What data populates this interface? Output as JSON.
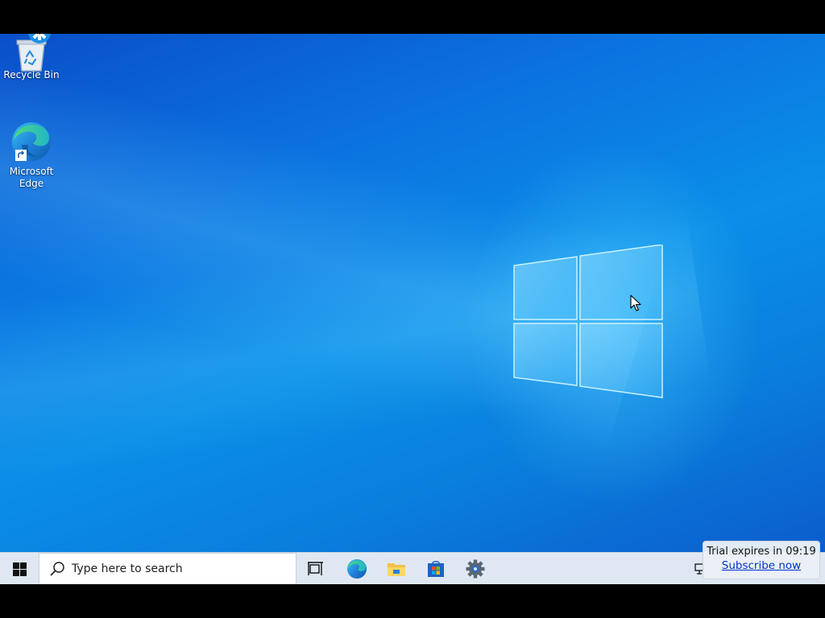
{
  "desktop": {
    "icons": [
      {
        "label": "Recycle Bin",
        "icon": "recycle-bin-icon"
      },
      {
        "label": "Microsoft\nEdge",
        "icon": "edge-icon"
      }
    ]
  },
  "taskbar": {
    "start_icon": "windows-start-icon",
    "search_placeholder": "Type here to search",
    "pinned": [
      {
        "name": "Task View",
        "icon": "task-view-icon"
      },
      {
        "name": "Microsoft Edge",
        "icon": "edge-icon"
      },
      {
        "name": "File Explorer",
        "icon": "folder-icon"
      },
      {
        "name": "Microsoft Store",
        "icon": "store-icon"
      },
      {
        "name": "Settings",
        "icon": "gear-icon"
      }
    ],
    "background": "#dfe8f2"
  },
  "trial_overlay": {
    "expiry_text": "Trial expires in 09:19",
    "subscribe_link": "Subscribe now"
  },
  "colors": {
    "wallpaper_accent": "#0a7fdd",
    "link": "#0033cc"
  }
}
